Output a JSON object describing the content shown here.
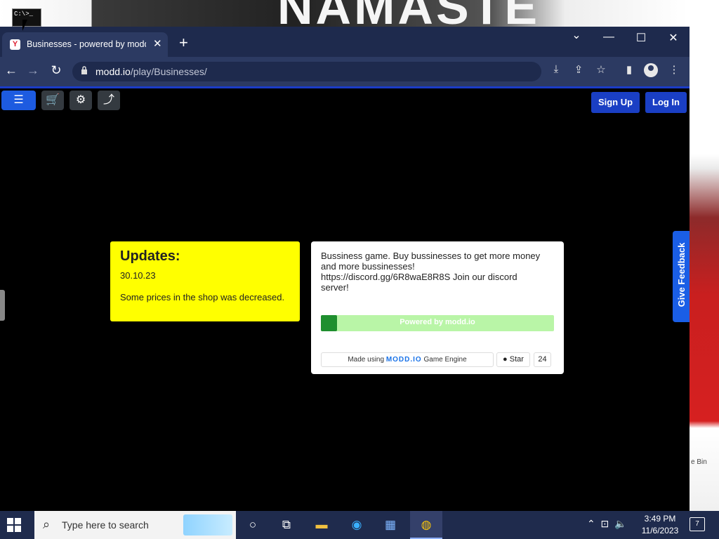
{
  "desktop": {
    "banner_text": "NAMASTE",
    "icon_label": "C:\\>_",
    "recycle_label": "e Bin"
  },
  "browser": {
    "tab_title": "Businesses - powered by modd.io",
    "tab_close": "✕",
    "new_tab": "+",
    "url_host": "modd.io",
    "url_path": "/play/Businesses/",
    "controls": {
      "dropdown": "⌄",
      "minimize": "—",
      "maximize": "☐",
      "close": "✕"
    }
  },
  "game": {
    "signup_label": "Sign Up",
    "login_label": "Log In",
    "updates": {
      "title": "Updates:",
      "date": "30.10.23",
      "message": "Some prices in the shop was decreased."
    },
    "info": {
      "description": "Bussiness game. Buy bussinesses to get more money and more bussinesses! https://discord.gg/6R8waE8R8S Join our discord server!",
      "progress_label": "Powered by modd.io",
      "progress_fraction": 0.07,
      "made_prefix": "Made using",
      "made_logo": "MODD.IO",
      "made_suffix": "Game Engine",
      "star_label": "Star",
      "star_count": "24"
    },
    "feedback_label": "Give Feedback"
  },
  "taskbar": {
    "search_placeholder": "Type here to search",
    "time": "3:49 PM",
    "date": "11/6/2023",
    "notification_count": "7"
  },
  "colors": {
    "accent_blue": "#1a3fc4",
    "updates_bg": "#ffff00",
    "progress_fill": "#1f8f2f",
    "progress_track": "#b9f5a7"
  }
}
